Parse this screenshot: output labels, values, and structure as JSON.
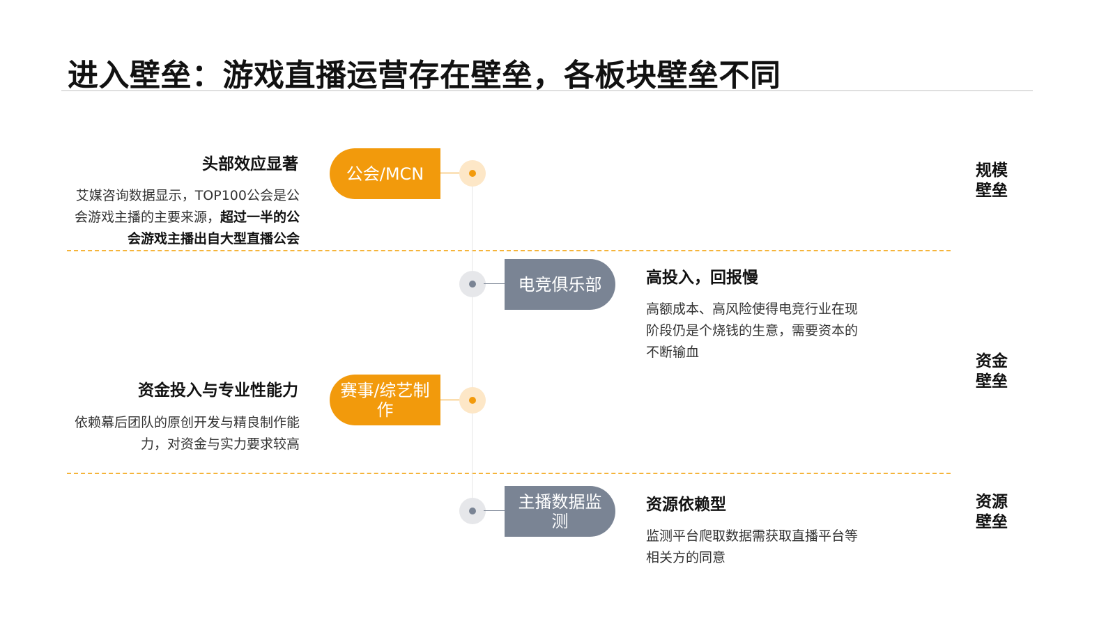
{
  "title": "进入壁垒：游戏直播运营存在壁垒，各板块壁垒不同",
  "colors": {
    "orange": "#f29a0c",
    "orange_light": "#fde7c7",
    "gray": "#7a8494",
    "gray_light": "#e6e7ea",
    "separator": "#f5b43a"
  },
  "items": [
    {
      "tag": "公会/MCN",
      "heading": "头部效应显著",
      "desc_normal": "艾媒咨询数据显示，TOP100公会是公会游戏主播的主要来源，",
      "desc_bold": "超过一半的公会游戏主播出自大型直播公会"
    },
    {
      "tag": "电竞俱乐部",
      "heading": "高投入，回报慢",
      "desc": "高额成本、高风险使得电竞行业在现阶段仍是个烧钱的生意，需要资本的不断输血"
    },
    {
      "tag": "赛事/综艺制作",
      "heading": "资金投入与专业性能力",
      "desc": "依赖幕后团队的原创开发与精良制作能力，对资金与实力要求较高"
    },
    {
      "tag": "主播数据监测",
      "heading": "资源依赖型",
      "desc": "监测平台爬取数据需获取直播平台等相关方的同意"
    }
  ],
  "barriers": [
    "规模壁垒",
    "资金壁垒",
    "资源壁垒"
  ]
}
